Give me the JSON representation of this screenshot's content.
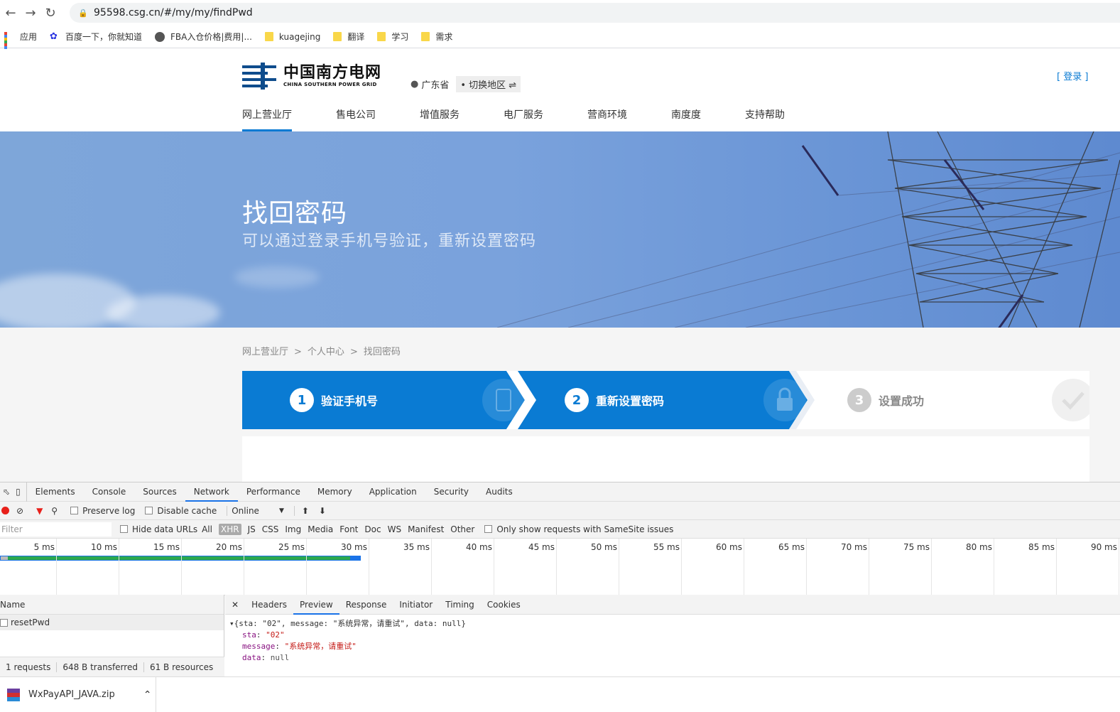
{
  "browser": {
    "url": "95598.csg.cn/#/my/my/findPwd",
    "bookmarks": [
      "应用",
      "百度一下，你就知道",
      "FBA入仓价格|费用|...",
      "kuagejing",
      "翻译",
      "学习",
      "需求"
    ]
  },
  "site": {
    "logo_cn": "中国南方电网",
    "logo_en": "CHINA SOUTHERN POWER GRID",
    "region": "广东省",
    "switch_region": "• 切换地区 ⇌",
    "login": "[ 登录 ]",
    "nav": [
      "网上营业厅",
      "售电公司",
      "增值服务",
      "电厂服务",
      "营商环境",
      "南度度",
      "支持帮助"
    ]
  },
  "banner": {
    "title": "找回密码",
    "subtitle": "可以通过登录手机号验证，重新设置密码"
  },
  "breadcrumb": [
    "网上营业厅",
    "个人中心",
    "找回密码"
  ],
  "breadcrumb_sep": ">",
  "steps": [
    {
      "num": "1",
      "label": "验证手机号"
    },
    {
      "num": "2",
      "label": "重新设置密码"
    },
    {
      "num": "3",
      "label": "设置成功"
    }
  ],
  "devtools": {
    "tabs": [
      "Elements",
      "Console",
      "Sources",
      "Network",
      "Performance",
      "Memory",
      "Application",
      "Security",
      "Audits"
    ],
    "toolbar": {
      "preserve_log": "Preserve log",
      "disable_cache": "Disable cache",
      "throttle": "Online"
    },
    "filter_placeholder": "Filter",
    "hide_data_urls": "Hide data URLs",
    "types": [
      "All",
      "XHR",
      "JS",
      "CSS",
      "Img",
      "Media",
      "Font",
      "Doc",
      "WS",
      "Manifest",
      "Other"
    ],
    "samesite": "Only show requests with SameSite issues",
    "ticks": [
      "5 ms",
      "10 ms",
      "15 ms",
      "20 ms",
      "25 ms",
      "30 ms",
      "35 ms",
      "40 ms",
      "45 ms",
      "50 ms",
      "55 ms",
      "60 ms",
      "65 ms",
      "70 ms",
      "75 ms",
      "80 ms",
      "85 ms",
      "90 ms"
    ],
    "name_header": "Name",
    "request": "resetPwd",
    "footer": [
      "1 requests",
      "648 B transferred",
      "61 B resources"
    ],
    "detail_tabs": [
      "Headers",
      "Preview",
      "Response",
      "Initiator",
      "Timing",
      "Cookies"
    ],
    "preview": {
      "summary": "{sta: \"02\", message: \"系统异常，请重试\", data: null}",
      "sta_key": "sta",
      "sta_val": "\"02\"",
      "msg_key": "message",
      "msg_val": "\"系统异常，请重试\"",
      "data_key": "data",
      "data_val": "null"
    }
  },
  "download": {
    "file": "WxPayAPI_JAVA.zip"
  }
}
